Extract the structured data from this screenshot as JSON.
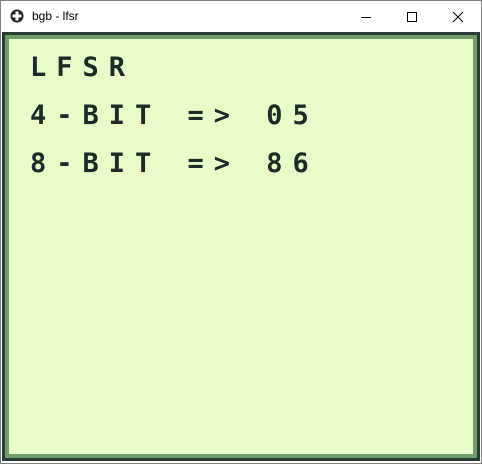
{
  "window": {
    "title": "bgb - lfsr",
    "icons": {
      "app": "gamepad-cross-icon",
      "minimize": "minimize-icon",
      "maximize": "maximize-icon",
      "close": "close-icon"
    }
  },
  "screen": {
    "lines": [
      "LFSR",
      "4-BIT => 05",
      "8-BIT => 86"
    ],
    "colors": {
      "background": "#e8fbc9",
      "text": "#1c2a28",
      "border_dark": "#2d3b37",
      "border_light": "#6e9d6a"
    }
  }
}
